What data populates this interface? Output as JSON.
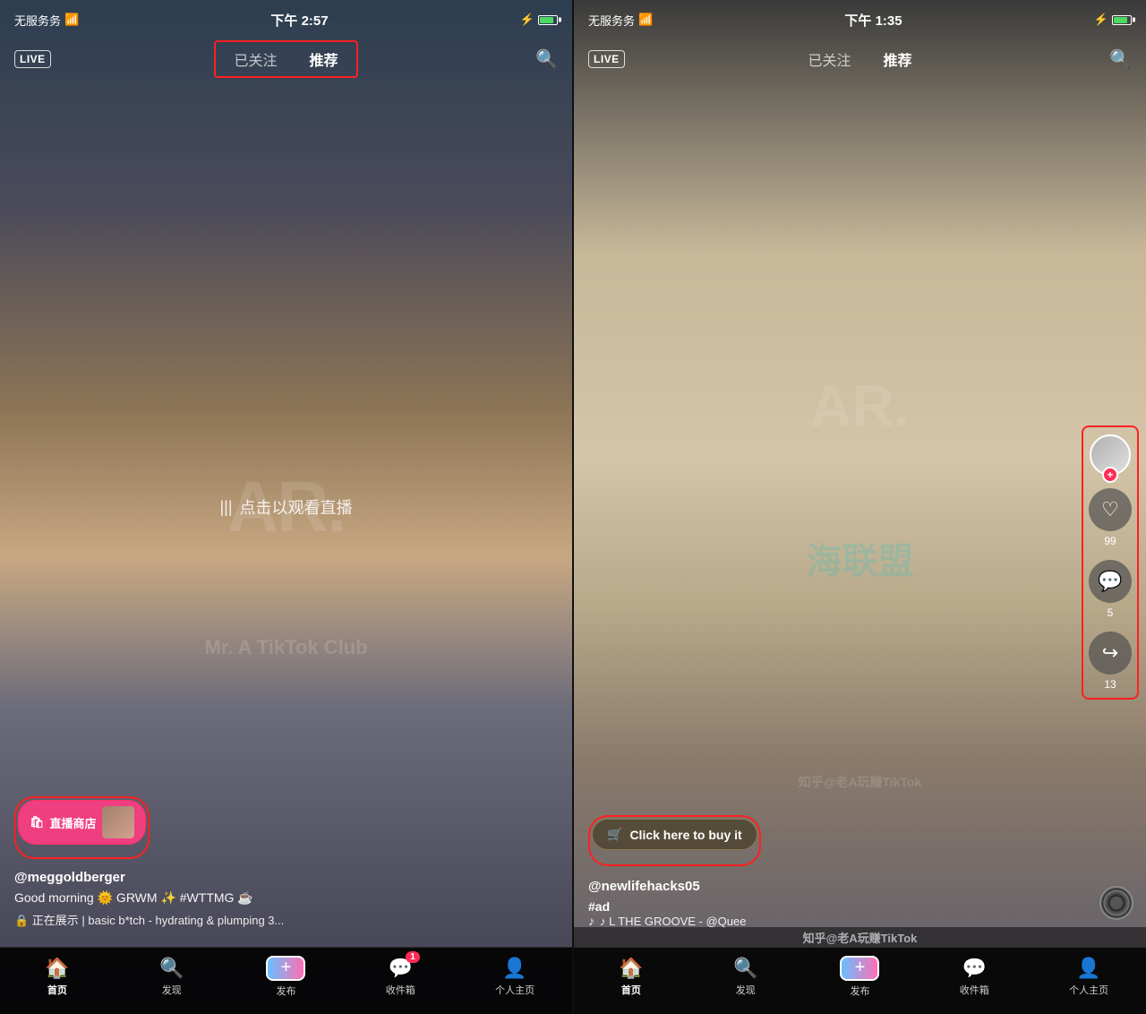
{
  "left_panel": {
    "status": {
      "signal": "无服务务",
      "wifi": "wifi",
      "time": "下午 2:57",
      "battery_charging": true
    },
    "nav": {
      "live_label": "LIVE",
      "tab_following": "已关注",
      "tab_recommend": "推荐",
      "tab_recommend_active": true,
      "search_icon": "search"
    },
    "video_overlay": {
      "icon": "|||",
      "text": "点击以观看直播"
    },
    "shop_button": {
      "icon": "🛍",
      "label": "直播商店"
    },
    "user": {
      "username": "@meggoldberger",
      "caption": "Good morning 🌞 GRWM ✨ #WTTMG ☕",
      "product": "🔒 正在展示 | basic b*tch - hydrating & plumping 3..."
    },
    "bottom_nav": {
      "items": [
        {
          "icon": "🏠",
          "label": "首页",
          "active": true
        },
        {
          "icon": "🔍",
          "label": "发现",
          "active": false
        },
        {
          "icon": "+",
          "label": "发布",
          "active": false,
          "is_publish": true
        },
        {
          "icon": "💬",
          "label": "收件箱",
          "active": false,
          "badge": "1"
        },
        {
          "icon": "👤",
          "label": "个人主页",
          "active": false
        }
      ]
    },
    "watermark": "AR.",
    "watermark_sub": "Mr. A TikTok Club"
  },
  "right_panel": {
    "status": {
      "signal": "无服务务",
      "wifi": "wifi",
      "time": "下午 1:35",
      "battery_charging": true
    },
    "nav": {
      "live_label": "LIVE",
      "tab_following": "已关注",
      "tab_recommend": "推荐",
      "tab_recommend_active": true,
      "search_icon": "search"
    },
    "buy_button": {
      "icon": "🛒",
      "label": "Click here to buy it"
    },
    "user": {
      "username": "@newlifehacks05",
      "hashtag": "#ad",
      "music": "♪ L THE GROOVE - @Quee"
    },
    "actions": [
      {
        "type": "avatar",
        "count": null
      },
      {
        "type": "like",
        "icon": "♡",
        "count": "99"
      },
      {
        "type": "comment",
        "icon": "💬",
        "count": "5"
      },
      {
        "type": "share",
        "icon": "↪",
        "count": "13"
      }
    ],
    "bottom_nav": {
      "items": [
        {
          "icon": "🏠",
          "label": "首页",
          "active": true
        },
        {
          "icon": "🔍",
          "label": "发现",
          "active": false
        },
        {
          "icon": "+",
          "label": "发布",
          "active": false,
          "is_publish": true
        },
        {
          "icon": "💬",
          "label": "收件箱",
          "active": false
        },
        {
          "icon": "👤",
          "label": "个人主页",
          "active": false
        }
      ]
    },
    "watermark_big": "AR.",
    "watermark_chinese": "海联盟",
    "watermark_sub": "知乎@老A玩赚TikTok"
  }
}
